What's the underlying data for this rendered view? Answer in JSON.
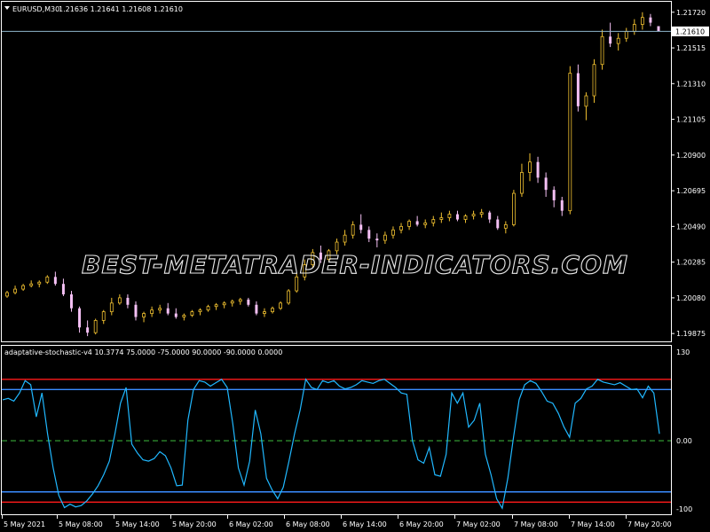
{
  "chart_data": [
    {
      "type": "candlestick",
      "symbol_label": "EURUSD,M30",
      "ohlc_label": "1.21636 1.21641 1.21608 1.21610",
      "current_price": 1.2161,
      "current_price_label": "1.21610",
      "yticks": [
        "1.21720",
        "1.21515",
        "1.21310",
        "1.21105",
        "1.20900",
        "1.20695",
        "1.20490",
        "1.20285",
        "1.20080",
        "1.19875"
      ],
      "ylim": [
        1.1983,
        1.2178
      ],
      "bull_color": "#f0c030",
      "bear_color": "#f4c0f4",
      "candles": [
        [
          1.2009,
          1.2012,
          1.2008,
          1.2011
        ],
        [
          1.2011,
          1.2015,
          1.201,
          1.2013
        ],
        [
          1.2013,
          1.2016,
          1.2012,
          1.2015
        ],
        [
          1.2015,
          1.2018,
          1.2014,
          1.2016
        ],
        [
          1.2016,
          1.2018,
          1.2014,
          1.2017
        ],
        [
          1.2017,
          1.2021,
          1.2016,
          1.202
        ],
        [
          1.202,
          1.2023,
          1.2015,
          1.2016
        ],
        [
          1.2016,
          1.2019,
          1.2009,
          1.201
        ],
        [
          1.201,
          1.2012,
          1.2,
          1.2002
        ],
        [
          1.2002,
          1.2003,
          1.1988,
          1.1991
        ],
        [
          1.1991,
          1.1995,
          1.1986,
          1.1988
        ],
        [
          1.1988,
          1.1996,
          1.1987,
          1.1995
        ],
        [
          1.1995,
          1.2001,
          1.1993,
          1.2
        ],
        [
          1.2,
          1.2008,
          1.1998,
          1.2005
        ],
        [
          1.2005,
          1.201,
          1.2004,
          1.2008
        ],
        [
          1.2008,
          1.201,
          1.2002,
          1.2004
        ],
        [
          1.2004,
          1.2006,
          1.1995,
          1.1997
        ],
        [
          1.1997,
          1.2,
          1.1994,
          1.1999
        ],
        [
          1.1999,
          1.2003,
          1.1997,
          1.2001
        ],
        [
          1.2001,
          1.2004,
          1.1999,
          1.2002
        ],
        [
          1.2002,
          1.2005,
          1.1998,
          1.1999
        ],
        [
          1.1999,
          1.2002,
          1.1996,
          1.1997
        ],
        [
          1.1997,
          1.1999,
          1.1995,
          1.1998
        ],
        [
          1.1998,
          1.2001,
          1.1997,
          1.2
        ],
        [
          1.2,
          1.2002,
          1.1998,
          1.2001
        ],
        [
          1.2001,
          1.2004,
          1.2,
          1.2003
        ],
        [
          1.2003,
          1.2005,
          1.2001,
          1.2004
        ],
        [
          1.2004,
          1.2006,
          1.2002,
          1.2005
        ],
        [
          1.2005,
          1.2007,
          1.2003,
          1.2006
        ],
        [
          1.2006,
          1.2008,
          1.2004,
          1.2007
        ],
        [
          1.2007,
          1.2008,
          1.2003,
          1.2004
        ],
        [
          1.2004,
          1.2006,
          1.1998,
          1.1999
        ],
        [
          1.1999,
          1.2002,
          1.1997,
          1.2
        ],
        [
          1.2,
          1.2003,
          1.1999,
          1.2002
        ],
        [
          1.2002,
          1.2006,
          1.2001,
          1.2005
        ],
        [
          1.2005,
          1.2013,
          1.2004,
          1.2012
        ],
        [
          1.2012,
          1.2022,
          1.2011,
          1.202
        ],
        [
          1.202,
          1.203,
          1.2018,
          1.2027
        ],
        [
          1.2027,
          1.2036,
          1.2025,
          1.2034
        ],
        [
          1.2034,
          1.2038,
          1.2028,
          1.203
        ],
        [
          1.203,
          1.2036,
          1.2029,
          1.2035
        ],
        [
          1.2035,
          1.2042,
          1.2033,
          1.204
        ],
        [
          1.204,
          1.2047,
          1.2038,
          1.2044
        ],
        [
          1.2044,
          1.2052,
          1.2042,
          1.205
        ],
        [
          1.205,
          1.2056,
          1.2045,
          1.2047
        ],
        [
          1.2047,
          1.2049,
          1.204,
          1.2042
        ],
        [
          1.2042,
          1.2045,
          1.2037,
          1.2041
        ],
        [
          1.2041,
          1.2046,
          1.2039,
          1.2044
        ],
        [
          1.2044,
          1.2049,
          1.2042,
          1.2047
        ],
        [
          1.2047,
          1.2051,
          1.2045,
          1.2049
        ],
        [
          1.2049,
          1.2053,
          1.2047,
          1.2052
        ],
        [
          1.2052,
          1.2055,
          1.2049,
          1.205
        ],
        [
          1.205,
          1.2053,
          1.2048,
          1.2051
        ],
        [
          1.2051,
          1.2055,
          1.2049,
          1.2053
        ],
        [
          1.2053,
          1.2057,
          1.2051,
          1.2054
        ],
        [
          1.2054,
          1.2058,
          1.2052,
          1.2056
        ],
        [
          1.2056,
          1.2058,
          1.2052,
          1.2053
        ],
        [
          1.2053,
          1.2056,
          1.2051,
          1.2055
        ],
        [
          1.2055,
          1.2058,
          1.2053,
          1.2056
        ],
        [
          1.2056,
          1.2059,
          1.2054,
          1.2057
        ],
        [
          1.2057,
          1.2058,
          1.2051,
          1.2053
        ],
        [
          1.2053,
          1.2055,
          1.2047,
          1.2048
        ],
        [
          1.2048,
          1.2052,
          1.2045,
          1.205
        ],
        [
          1.205,
          1.207,
          1.2049,
          1.2068
        ],
        [
          1.2068,
          1.2085,
          1.2066,
          1.208
        ],
        [
          1.208,
          1.2091,
          1.2075,
          1.2086
        ],
        [
          1.2086,
          1.2089,
          1.2074,
          1.2077
        ],
        [
          1.2077,
          1.208,
          1.2066,
          1.207
        ],
        [
          1.207,
          1.2072,
          1.206,
          1.2064
        ],
        [
          1.2064,
          1.2066,
          1.2055,
          1.2058
        ],
        [
          1.2058,
          1.2141,
          1.2056,
          1.2137
        ],
        [
          1.2137,
          1.2142,
          1.2115,
          1.2118
        ],
        [
          1.2118,
          1.2126,
          1.211,
          1.2124
        ],
        [
          1.2124,
          1.2145,
          1.212,
          1.2142
        ],
        [
          1.2142,
          1.2162,
          1.2139,
          1.2158
        ],
        [
          1.2158,
          1.2166,
          1.2152,
          1.2154
        ],
        [
          1.2154,
          1.216,
          1.215,
          1.2157
        ],
        [
          1.2157,
          1.2163,
          1.2155,
          1.2161
        ],
        [
          1.2161,
          1.2168,
          1.2159,
          1.2165
        ],
        [
          1.2165,
          1.2172,
          1.2162,
          1.2169
        ],
        [
          1.2169,
          1.2171,
          1.2164,
          1.2166
        ],
        [
          1.2164,
          1.2164,
          1.2161,
          1.2161
        ]
      ]
    },
    {
      "type": "line",
      "indicator_label": "adaptative-stochastic-v4 10.3774 75.0000 -75.0000 90.0000 -90.0000 0.0000",
      "yticks": [
        "130",
        "0.00",
        "-100"
      ],
      "ylim": [
        -100,
        130
      ],
      "levels": [
        {
          "value": 90,
          "color": "#ff1a1a"
        },
        {
          "value": 75,
          "color": "#3a8cff"
        },
        {
          "value": 0,
          "color": "#2e8b2e",
          "dashed": true
        },
        {
          "value": -75,
          "color": "#3a8cff"
        },
        {
          "value": -90,
          "color": "#ff1a1a"
        }
      ],
      "line_color": "#20b8ff",
      "values": [
        60,
        62,
        58,
        70,
        88,
        82,
        35,
        70,
        10,
        -40,
        -80,
        -98,
        -93,
        -97,
        -95,
        -88,
        -78,
        -66,
        -50,
        -30,
        10,
        55,
        78,
        -5,
        -18,
        -28,
        -30,
        -26,
        -16,
        -22,
        -40,
        -66,
        -65,
        30,
        75,
        88,
        86,
        80,
        85,
        90,
        78,
        25,
        -40,
        -65,
        -30,
        45,
        10,
        -55,
        -72,
        -85,
        -68,
        -30,
        10,
        45,
        90,
        78,
        75,
        88,
        85,
        88,
        80,
        76,
        78,
        82,
        88,
        86,
        84,
        88,
        90,
        84,
        78,
        70,
        68,
        0,
        -28,
        -33,
        -10,
        -50,
        -52,
        -20,
        70,
        55,
        70,
        20,
        30,
        55,
        -20,
        -50,
        -85,
        -99,
        -55,
        5,
        60,
        82,
        88,
        84,
        72,
        58,
        55,
        40,
        20,
        5,
        55,
        62,
        76,
        80,
        90,
        86,
        84,
        82,
        85,
        80,
        75,
        76,
        63,
        80,
        70,
        10
      ],
      "xticks": [
        "5 May 2021",
        "5 May 08:00",
        "5 May 14:00",
        "5 May 20:00",
        "6 May 02:00",
        "6 May 08:00",
        "6 May 14:00",
        "6 May 20:00",
        "7 May 02:00",
        "7 May 08:00",
        "7 May 14:00",
        "7 May 20:00"
      ]
    }
  ],
  "watermark": "BEST-METATRADER-INDICATORS.COM",
  "colors": {
    "background": "#000000",
    "axis": "#ffffff",
    "price_line": "#8fb6cc"
  }
}
